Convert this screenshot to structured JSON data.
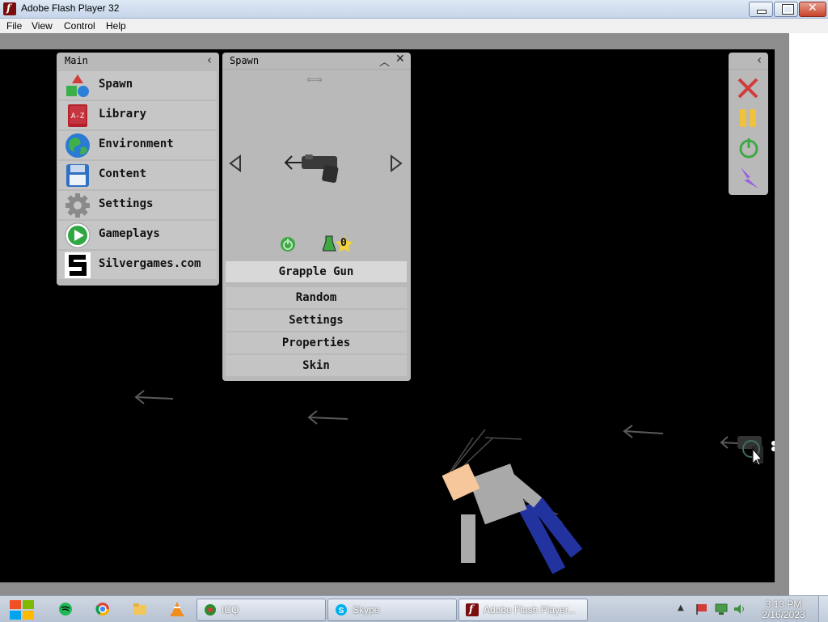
{
  "window": {
    "title": "Adobe Flash Player 32"
  },
  "menubar": {
    "items": [
      "File",
      "View",
      "Control",
      "Help"
    ]
  },
  "main_panel": {
    "title": "Main",
    "items": [
      {
        "label": "Spawn",
        "icon": "shapes-icon"
      },
      {
        "label": "Library",
        "icon": "book-az-icon"
      },
      {
        "label": "Environment",
        "icon": "globe-icon"
      },
      {
        "label": "Content",
        "icon": "floppy-disk-icon"
      },
      {
        "label": "Settings",
        "icon": "gear-icon"
      },
      {
        "label": "Gameplays",
        "icon": "play-icon"
      },
      {
        "label": "Silvergames.com",
        "icon": "silvergames-logo-icon"
      }
    ]
  },
  "spawn_panel": {
    "title": "Spawn",
    "item_name": "Grapple Gun",
    "count": "0",
    "buttons": [
      "Random",
      "Settings",
      "Properties",
      "Skin"
    ]
  },
  "taskbar": {
    "tasks": [
      "ICQ",
      "Skype",
      "Adobe Flash Player..."
    ],
    "time": "3:13 PM",
    "date": "2/16/2023"
  },
  "colors": {
    "panel_bg": "#b9b9b9",
    "row_bg": "#c6c6c6",
    "stage_bg": "#000000",
    "ragdoll_shirt": "#a9a9a9",
    "ragdoll_pants": "#2233a0",
    "ragdoll_skin": "#f5c79b"
  }
}
